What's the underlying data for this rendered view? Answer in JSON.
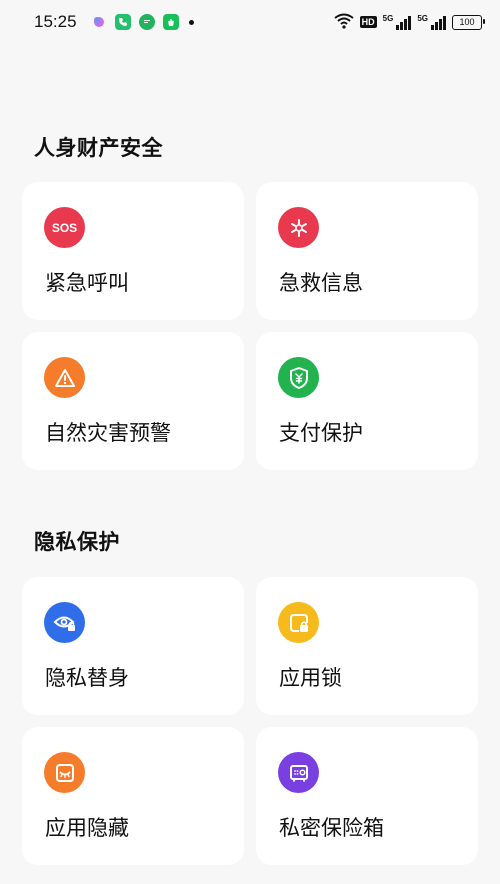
{
  "status": {
    "time": "15:25",
    "battery": "100",
    "hd_label": "HD",
    "net1": "5G",
    "net2": "5G"
  },
  "sections": [
    {
      "title": "人身财产安全",
      "items": [
        {
          "label": "紧急呼叫",
          "icon": "sos-icon",
          "icon_text": "SOS",
          "color": "#e9394f"
        },
        {
          "label": "急救信息",
          "icon": "medical-asterisk-icon",
          "color": "#e9394f"
        },
        {
          "label": "自然灾害预警",
          "icon": "warning-triangle-icon",
          "color": "#f57c2a"
        },
        {
          "label": "支付保护",
          "icon": "yuan-shield-icon",
          "color": "#22b34f"
        }
      ]
    },
    {
      "title": "隐私保护",
      "items": [
        {
          "label": "隐私替身",
          "icon": "eye-lock-icon",
          "color": "#2f6ee8"
        },
        {
          "label": "应用锁",
          "icon": "app-lock-icon",
          "color": "#f6ba1c"
        },
        {
          "label": "应用隐藏",
          "icon": "app-hide-icon",
          "color": "#f57c2a"
        },
        {
          "label": "私密保险箱",
          "icon": "safe-box-icon",
          "color": "#7a3fe0"
        }
      ]
    }
  ]
}
